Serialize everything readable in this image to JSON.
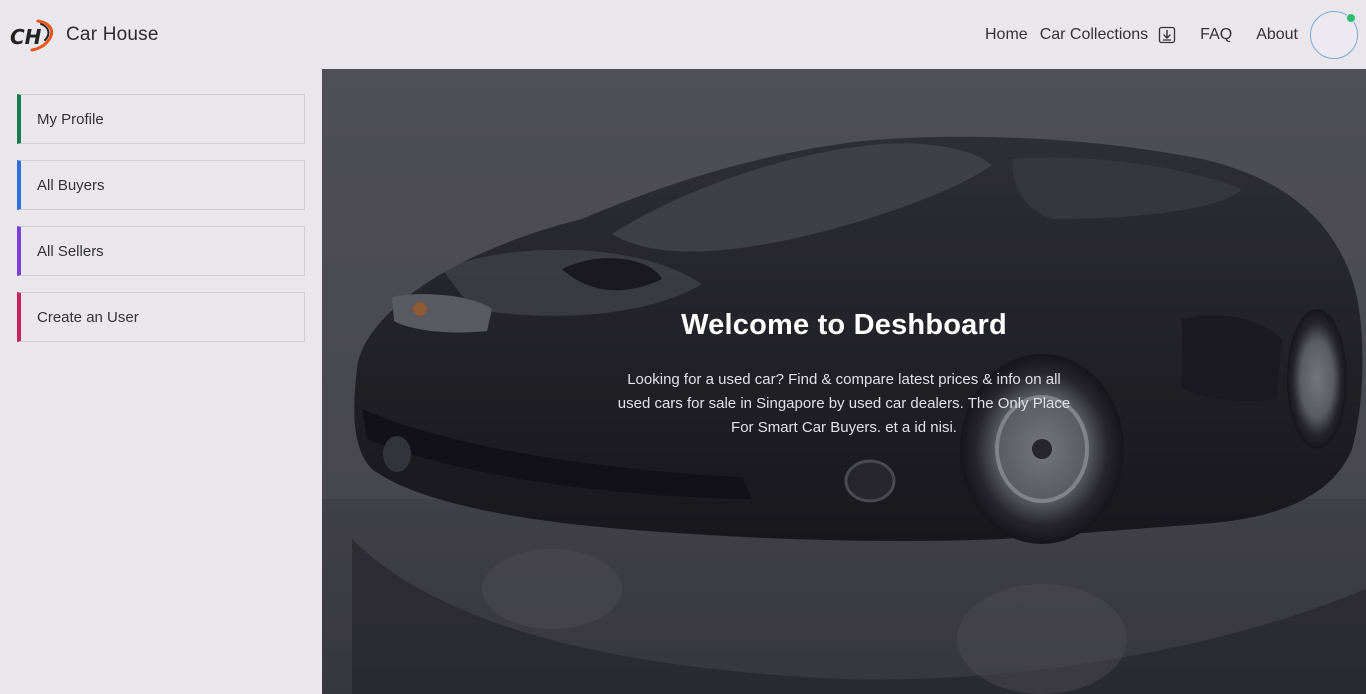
{
  "brand": {
    "logo_text": "CH",
    "name": "Car House"
  },
  "nav": {
    "home": "Home",
    "car_collections": "Car Collections",
    "faq": "FAQ",
    "about": "About"
  },
  "sidebar": {
    "items": [
      {
        "label": "My Profile",
        "accent": "#1a7a4c"
      },
      {
        "label": "All Buyers",
        "accent": "#2f6fdc"
      },
      {
        "label": "All Sellers",
        "accent": "#7b3fe0"
      },
      {
        "label": "Create an User",
        "accent": "#c8265f"
      }
    ]
  },
  "hero": {
    "title": "Welcome to Deshboard",
    "text": "Looking for a used car? Find & compare latest prices & info on all used cars for sale in Singapore by used car dealers. The Only Place For Smart Car Buyers. et a id nisi."
  },
  "colors": {
    "background": "#e9e7ec",
    "status_online": "#2ebc73",
    "logo_accent": "#e8561c"
  },
  "icons": {
    "download": "download-icon",
    "avatar": "user-avatar"
  }
}
